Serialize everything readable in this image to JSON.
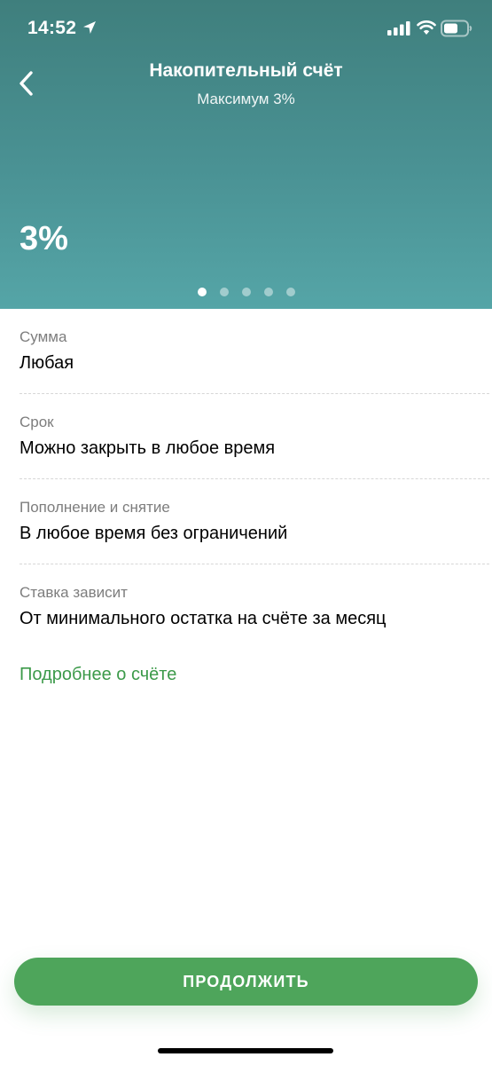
{
  "status_bar": {
    "time": "14:52"
  },
  "header": {
    "title": "Накопительный счёт",
    "subtitle": "Максимум 3%",
    "rate": "3%",
    "pager": {
      "count": 5,
      "active_index": 0
    },
    "gradient_top": "#3f7f7d",
    "gradient_bottom": "#55a5a7"
  },
  "info": [
    {
      "label": "Сумма",
      "value": "Любая"
    },
    {
      "label": "Срок",
      "value": "Можно закрыть в любое время"
    },
    {
      "label": "Пополнение и снятие",
      "value": "В любое время без ограничений"
    },
    {
      "label": "Ставка зависит",
      "value": "От минимального остатка на счёте за месяц"
    }
  ],
  "more_link": "Подробнее о счёте",
  "continue_label": "ПРОДОЛЖИТЬ",
  "colors": {
    "accent": "#4ea55b",
    "link": "#3c9a4a"
  },
  "icons": {
    "back": "chevron-left-icon",
    "location": "location-arrow-icon",
    "signal": "cellular-signal-icon",
    "wifi": "wifi-icon",
    "battery": "battery-icon"
  }
}
